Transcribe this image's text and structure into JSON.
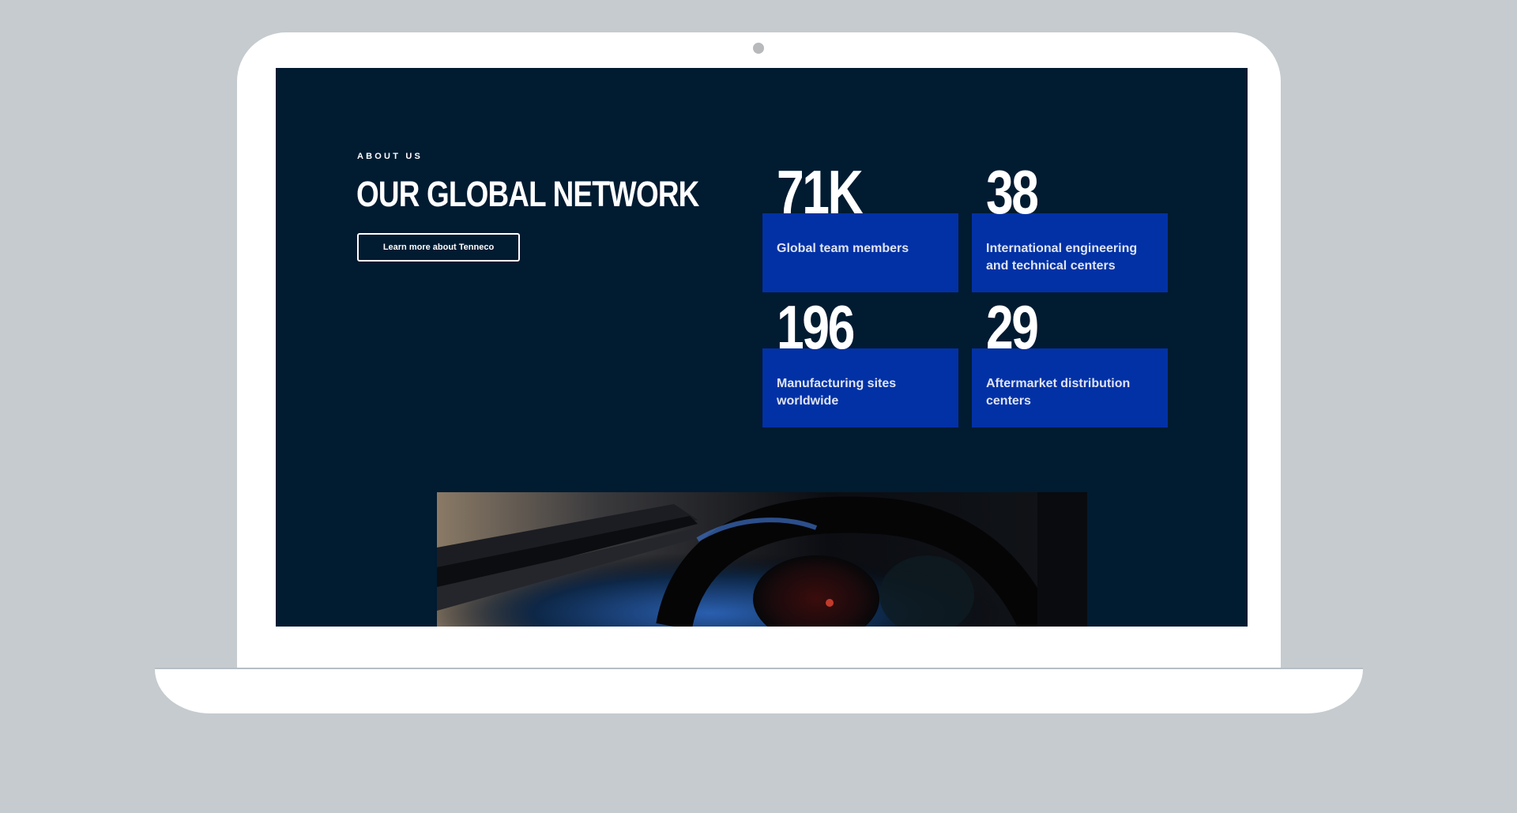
{
  "about": {
    "eyebrow": "ABOUT US",
    "title": "OUR GLOBAL NETWORK",
    "cta_label": "Learn more about Tenneco"
  },
  "stats": [
    {
      "value": "71K",
      "label": "Global team members"
    },
    {
      "value": "38",
      "label": "International engineering and technical centers"
    },
    {
      "value": "196",
      "label": "Manufacturing sites worldwide"
    },
    {
      "value": "29",
      "label": "Aftermarket distribution centers"
    }
  ],
  "colors": {
    "background": "#c5cbce",
    "screen": "#011b31",
    "stat_box": "#0231a6",
    "text": "#ffffff"
  },
  "image": {
    "subject": "car-dashboard-photo"
  }
}
